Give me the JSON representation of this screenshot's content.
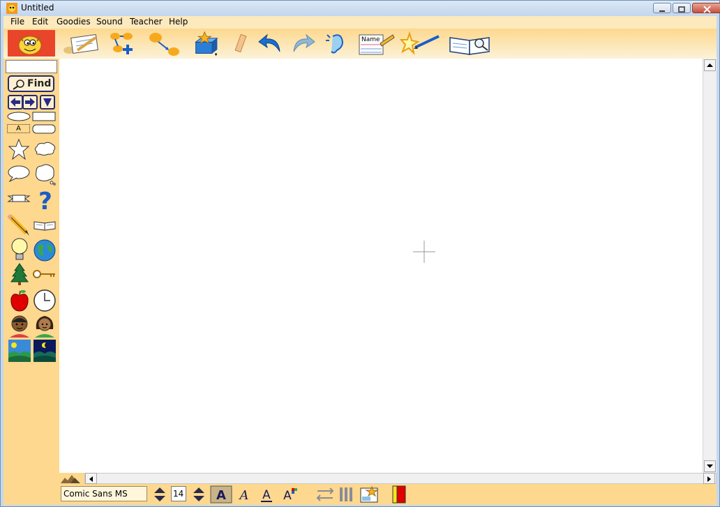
{
  "window": {
    "title": "Untitled"
  },
  "menu": {
    "items": [
      "File",
      "Edit",
      "Goodies",
      "Sound",
      "Teacher",
      "Help"
    ]
  },
  "palette": {
    "search_value": "",
    "find_label": "Find",
    "text_box_glyph": "A"
  },
  "bottombar": {
    "font_name": "Comic Sans MS",
    "font_size": "14"
  },
  "colors": {
    "toolbar": "#fdd88e",
    "menu": "#fce9bd",
    "palette": "#fdd88e",
    "accent_blue": "#1a5dc8",
    "text_color_swatch": "#e00000"
  }
}
